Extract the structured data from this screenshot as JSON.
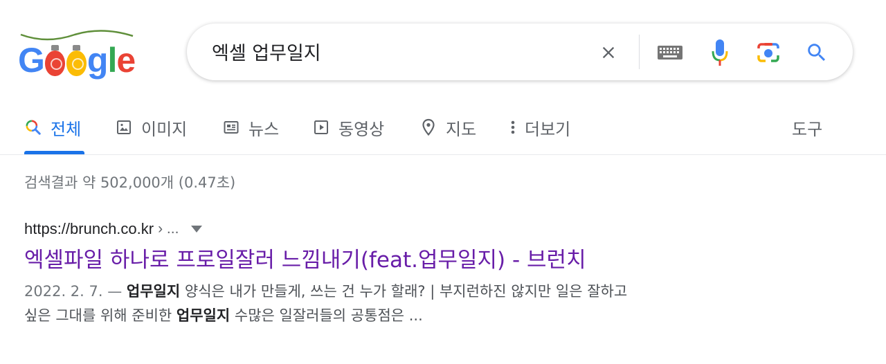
{
  "search": {
    "query": "엑셀 업무일지"
  },
  "tabs": [
    {
      "label": "전체",
      "icon": "search-multicolor-icon",
      "active": true
    },
    {
      "label": "이미지",
      "icon": "image-icon",
      "active": false
    },
    {
      "label": "뉴스",
      "icon": "news-icon",
      "active": false
    },
    {
      "label": "동영상",
      "icon": "video-icon",
      "active": false
    },
    {
      "label": "지도",
      "icon": "map-pin-icon",
      "active": false
    },
    {
      "label": "더보기",
      "icon": "more-vert-icon",
      "active": false
    }
  ],
  "tools_label": "도구",
  "stats": "검색결과 약 502,000개 (0.47초)",
  "result": {
    "url": "https://brunch.co.kr",
    "breadcrumb": "› ...",
    "title": "엑셀파일 하나로 프로일잘러 느낌내기(feat.업무일지) - 브런치",
    "snippet_date": "2022. 2. 7. —",
    "snippet_bold_1": "업무일지",
    "snippet_text_1": "양식은 내가 만들게, 쓰는 건 누가 할래? | 부지런하진 않지만 일은 잘하고",
    "snippet_text_2": "싶은 그대를 위해 준비한",
    "snippet_bold_2": "업무일지",
    "snippet_text_3": "수많은 일잘러들의 공통점은 ..."
  },
  "colors": {
    "accent": "#1a73e8",
    "visited_link": "#681da8",
    "text_secondary": "#70757a"
  }
}
